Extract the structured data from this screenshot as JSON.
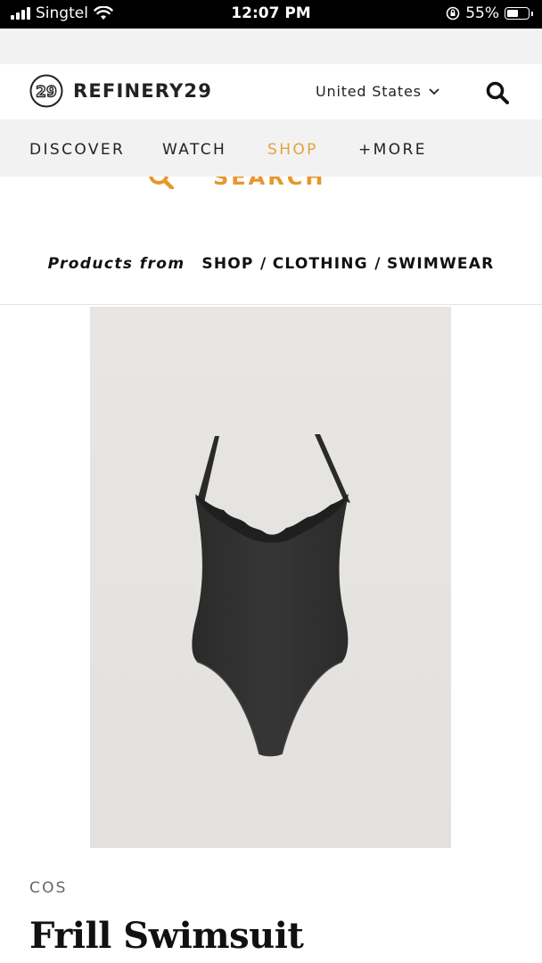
{
  "status_bar": {
    "carrier": "Singtel",
    "time": "12:07 PM",
    "battery": "55%",
    "battery_level": 0.55
  },
  "header": {
    "logo_text": "REFINERY29",
    "region": "United States",
    "icons": [
      "refinery29-logo-icon",
      "chevron-down-icon",
      "search-icon"
    ]
  },
  "nav": {
    "items": [
      {
        "label": "DISCOVER"
      },
      {
        "label": "WATCH"
      },
      {
        "label": "SHOP"
      },
      {
        "label": "+MORE"
      }
    ],
    "active": "SHOP",
    "active_color": "#e8a03b"
  },
  "search": {
    "label": "SEARCH",
    "color": "#e8962b"
  },
  "breadcrumb": {
    "prefix": "Products from",
    "items": [
      "SHOP",
      "CLOTHING",
      "SWIMWEAR"
    ],
    "separator": "/"
  },
  "product": {
    "brand": "COS",
    "title": "Frill Swimsuit",
    "image_icon": "swimsuit-image"
  }
}
